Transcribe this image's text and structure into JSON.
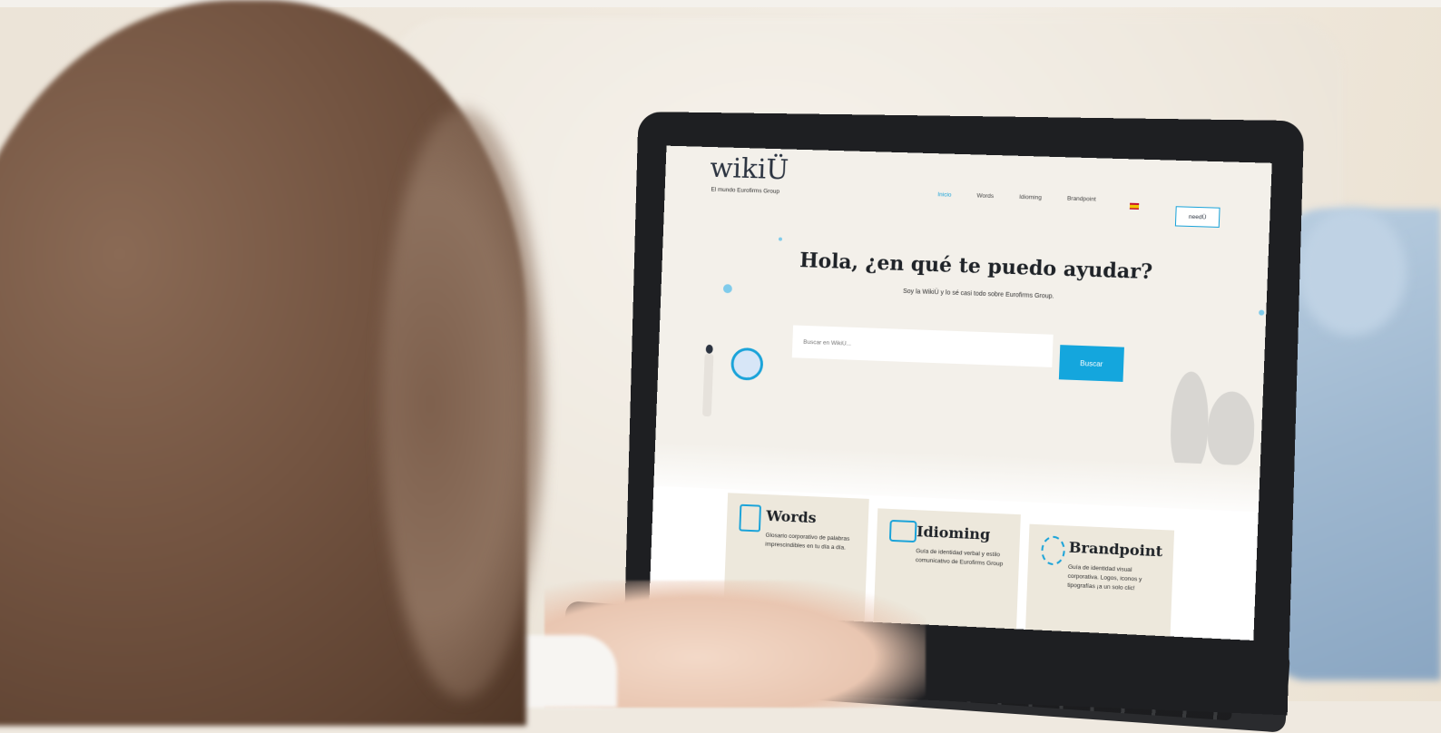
{
  "scene": {
    "description_colors": {
      "accent": "#14a6dd",
      "hair": "#6b4c3a",
      "background": "#efe9e0"
    }
  },
  "site": {
    "logo": "wikiÜ",
    "tagline": "El mundo Eurofirms Group",
    "nav": [
      {
        "label": "Inicio"
      },
      {
        "label": "Words"
      },
      {
        "label": "Idioming"
      },
      {
        "label": "Brandpoint"
      }
    ],
    "need_button": "needÜ",
    "hero": {
      "title": "Hola, ¿en qué te puedo ayudar?",
      "subtitle": "Soy la WikiÜ y lo sé casi todo sobre Eurofirms Group.",
      "search_placeholder": "Buscar en WikiÜ...",
      "search_button": "Buscar"
    },
    "cards": [
      {
        "title": "Words",
        "text": "Glosario corporativo de palabras imprescindibles en tu día a día."
      },
      {
        "title": "Idioming",
        "text": "Guía de identidad verbal y estilo comunicativo de Eurofirms Group"
      },
      {
        "title": "Brandpoint",
        "text": "Guía de identidad visual corporativa. Logos, iconos y tipografías ¡a un solo clic!"
      }
    ]
  }
}
